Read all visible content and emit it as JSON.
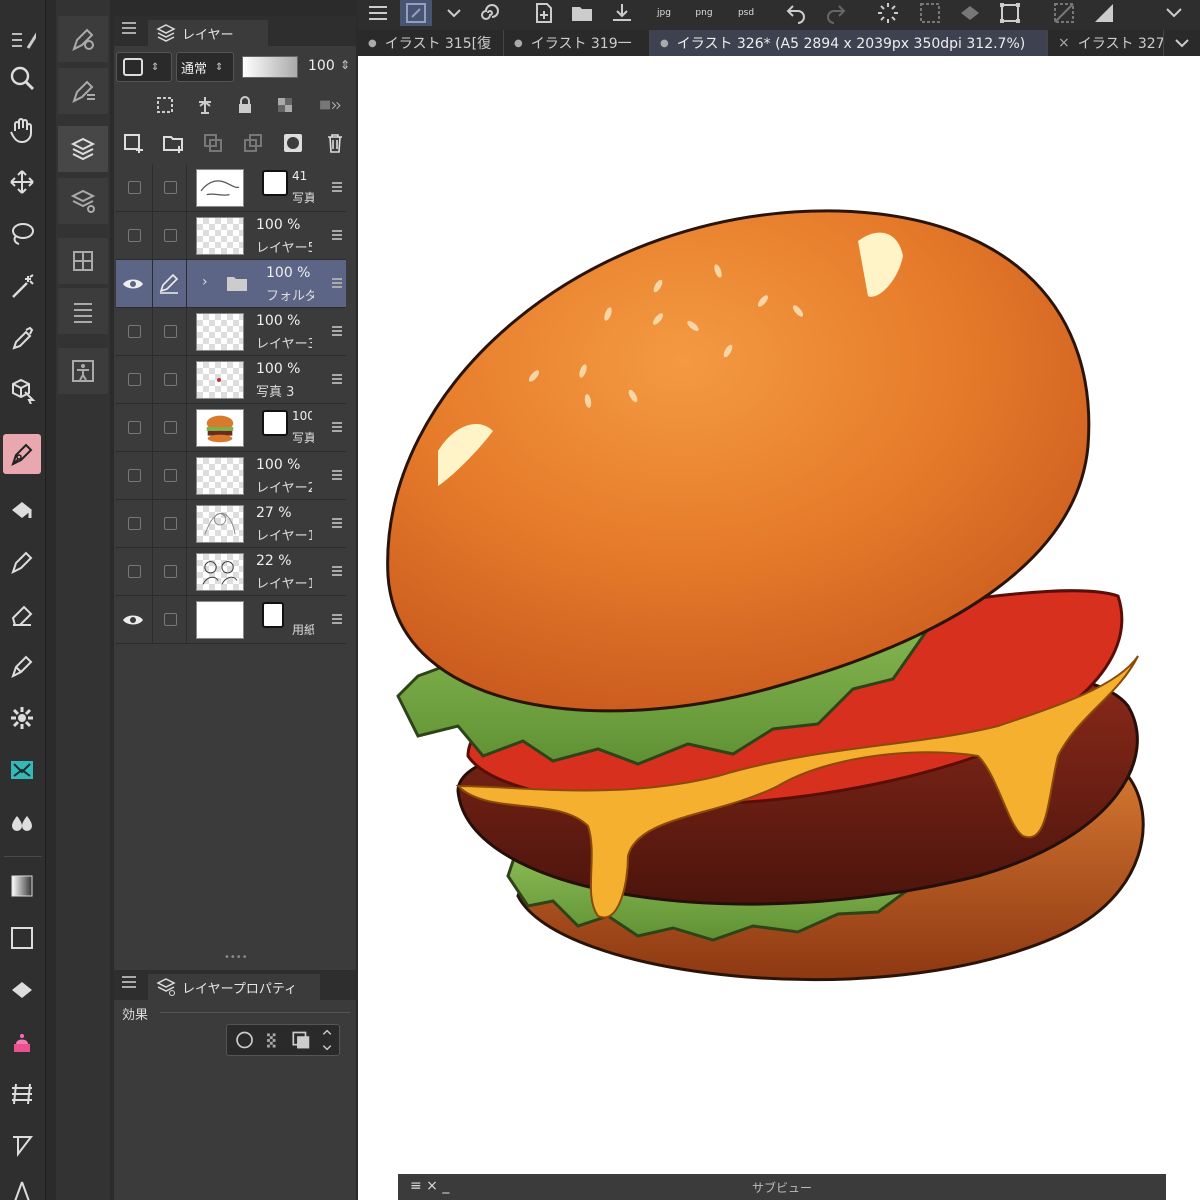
{
  "layer_panel": {
    "tab_label": "レイヤー",
    "blend_mode": "通常",
    "opacity_value": "100",
    "layers": [
      {
        "pct": "41",
        "name": "写真",
        "visible": false,
        "thumb": "hand-sketch",
        "has_mask": true
      },
      {
        "pct": "100 %",
        "name": "レイヤー5",
        "visible": false,
        "thumb": "transparent"
      },
      {
        "pct": "100 %",
        "name": "フォルダ",
        "visible": true,
        "thumb": "folder",
        "selected": true
      },
      {
        "pct": "100 %",
        "name": "レイヤー3",
        "visible": false,
        "thumb": "transparent"
      },
      {
        "pct": "100 %",
        "name": "写真 3",
        "visible": false,
        "thumb": "transparent-dot"
      },
      {
        "pct": "100",
        "name": "写真",
        "visible": false,
        "thumb": "burger-photo",
        "has_mask": true
      },
      {
        "pct": "100 %",
        "name": "レイヤー2",
        "visible": false,
        "thumb": "transparent"
      },
      {
        "pct": "27 %",
        "name": "レイヤー1",
        "visible": false,
        "thumb": "sketch"
      },
      {
        "pct": "22 %",
        "name": "レイヤー1",
        "visible": false,
        "thumb": "sketch"
      },
      {
        "pct": "",
        "name": "用紙",
        "visible": true,
        "thumb": "white",
        "has_mask": true
      }
    ]
  },
  "property_panel": {
    "tab_label": "レイヤープロパティ",
    "effect_label": "効果"
  },
  "tabs": [
    {
      "label": "イラスト 315[復"
    },
    {
      "label": "イラスト 319一"
    },
    {
      "label": "イラスト 326* (A5 2894 x 2039px 350dpi 312.7%)"
    },
    {
      "label": "イラスト 327"
    }
  ],
  "toolbar": {
    "jpg": "jpg",
    "png": "png",
    "psd": "psd"
  },
  "subview": {
    "title": "サブビュー"
  },
  "colors": {
    "selected_layer": "#5c6585",
    "active_tool": "#e9a7b0",
    "panel": "#3b3b3b"
  }
}
